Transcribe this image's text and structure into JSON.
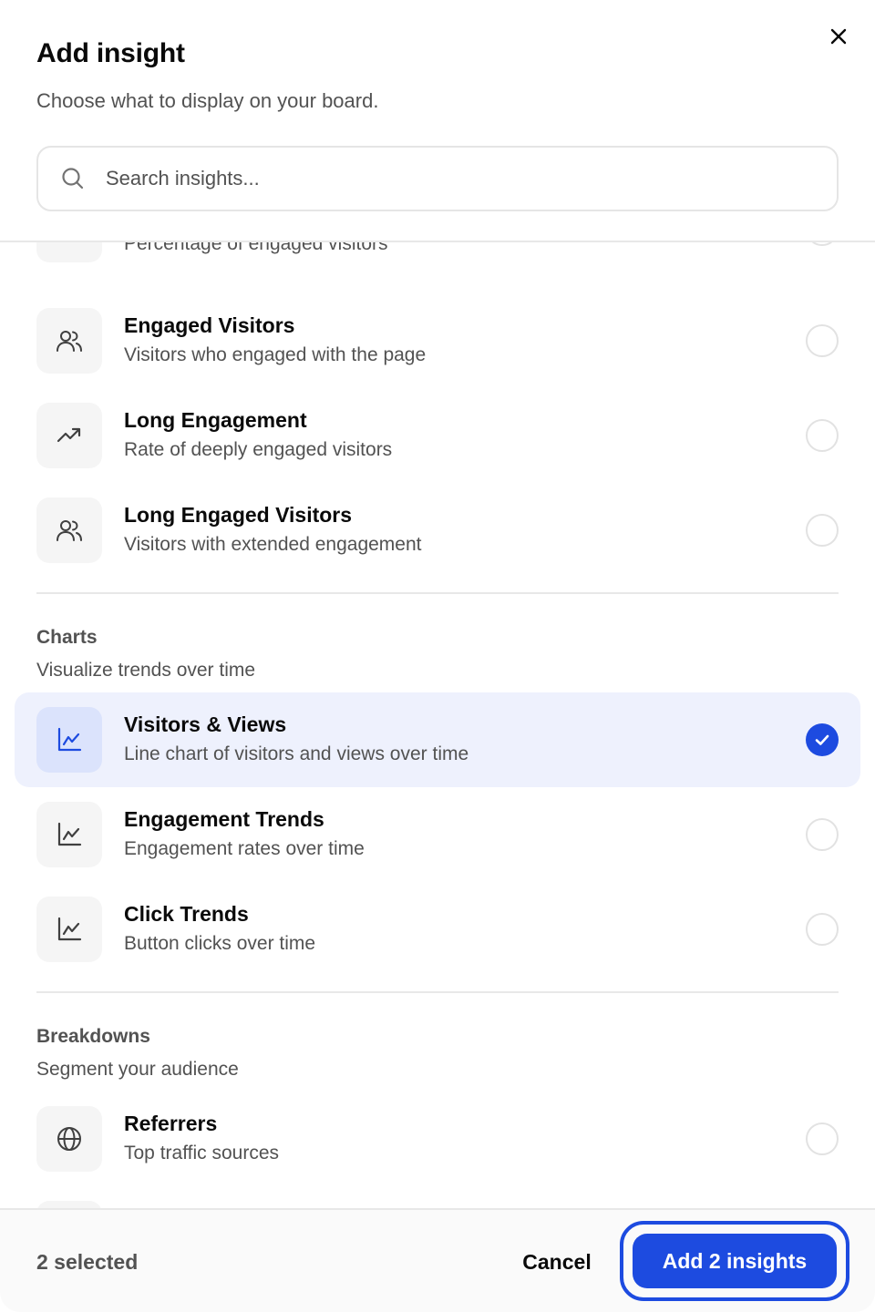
{
  "dialog": {
    "title": "Add insight",
    "subtitle": "Choose what to display on your board.",
    "close_icon": "close-icon"
  },
  "search": {
    "placeholder": "Search insights..."
  },
  "sections": {
    "partial_item": {
      "desc": "Percentage of engaged visitors",
      "icon": "trending-up-icon",
      "selected": false
    },
    "top_items": [
      {
        "name": "Engaged Visitors",
        "desc": "Visitors who engaged with the page",
        "icon": "users-icon",
        "selected": false
      },
      {
        "name": "Long Engagement",
        "desc": "Rate of deeply engaged visitors",
        "icon": "trending-up-icon",
        "selected": false
      },
      {
        "name": "Long Engaged Visitors",
        "desc": "Visitors with extended engagement",
        "icon": "users-icon",
        "selected": false
      }
    ],
    "charts": {
      "title": "Charts",
      "subtitle": "Visualize trends over time",
      "items": [
        {
          "name": "Visitors & Views",
          "desc": "Line chart of visitors and views over time",
          "icon": "line-chart-icon",
          "selected": true
        },
        {
          "name": "Engagement Trends",
          "desc": "Engagement rates over time",
          "icon": "line-chart-icon",
          "selected": false
        },
        {
          "name": "Click Trends",
          "desc": "Button clicks over time",
          "icon": "line-chart-icon",
          "selected": false
        }
      ]
    },
    "breakdowns": {
      "title": "Breakdowns",
      "subtitle": "Segment your audience",
      "items": [
        {
          "name": "Referrers",
          "desc": "Top traffic sources",
          "icon": "globe-icon",
          "selected": false
        }
      ]
    }
  },
  "footer": {
    "selected_count": "2 selected",
    "cancel_label": "Cancel",
    "add_label": "Add 2 insights"
  },
  "colors": {
    "accent": "#1d4be0",
    "selected_bg": "#eef1fd",
    "muted_text": "#525252"
  }
}
